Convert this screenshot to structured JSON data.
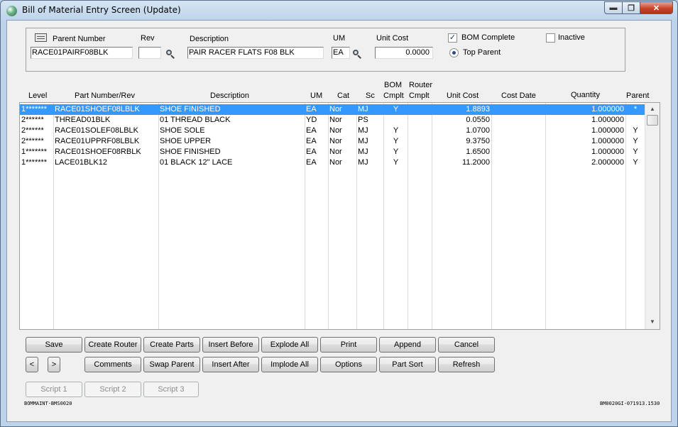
{
  "window": {
    "title": "Bill of Material Entry Screen (Update)",
    "min_glyph": "▬",
    "max_glyph": "❐",
    "close_glyph": "✕"
  },
  "header": {
    "parent_number_label": "Parent Number",
    "parent_number_value": "RACE01PAIRF08BLK",
    "rev_label": "Rev",
    "rev_value": "",
    "description_label": "Description",
    "description_value": "PAIR RACER FLATS F08 BLK",
    "um_label": "UM",
    "um_value": "EA",
    "unit_cost_label": "Unit Cost",
    "unit_cost_value": "0.0000",
    "bom_complete_label": "BOM Complete",
    "bom_complete_checked": true,
    "inactive_label": "Inactive",
    "inactive_checked": false,
    "top_parent_label": "Top Parent",
    "top_parent_selected": true
  },
  "grid": {
    "columns": {
      "level": "Level",
      "part": "Part Number/Rev",
      "description": "Description",
      "um": "UM",
      "cat": "Cat",
      "sc": "Sc",
      "bom_cmplt_1": "BOM",
      "bom_cmplt_2": "Cmplt",
      "router_cmplt_1": "Router",
      "router_cmplt_2": "Cmplt",
      "unit_cost": "Unit Cost",
      "cost_date": "Cost Date",
      "quantity": "Quantity",
      "parent": "Parent"
    },
    "rows": [
      {
        "level": "1*******",
        "part": "RACE01SHOEF08LBLK",
        "description": "SHOE FINISHED",
        "um": "EA",
        "cat": "Nor",
        "sc": "MJ",
        "bom": "Y",
        "router": "",
        "unit_cost": "1.8893",
        "cost_date": "",
        "quantity": "1.000000",
        "parent": "*"
      },
      {
        "level": "2******",
        "part": "THREAD01BLK",
        "description": "01 THREAD BLACK",
        "um": "YD",
        "cat": "Nor",
        "sc": "PS",
        "bom": "",
        "router": "",
        "unit_cost": "0.0550",
        "cost_date": "",
        "quantity": "1.000000",
        "parent": ""
      },
      {
        "level": "2******",
        "part": "RACE01SOLEF08LBLK",
        "description": "SHOE SOLE",
        "um": "EA",
        "cat": "Nor",
        "sc": "MJ",
        "bom": "Y",
        "router": "",
        "unit_cost": "1.0700",
        "cost_date": "",
        "quantity": "1.000000",
        "parent": "Y"
      },
      {
        "level": "2******",
        "part": "RACE01UPPRF08LBLK",
        "description": "SHOE UPPER",
        "um": "EA",
        "cat": "Nor",
        "sc": "MJ",
        "bom": "Y",
        "router": "",
        "unit_cost": "9.3750",
        "cost_date": "",
        "quantity": "1.000000",
        "parent": "Y"
      },
      {
        "level": "1*******",
        "part": "RACE01SHOEF08RBLK",
        "description": "SHOE FINISHED",
        "um": "EA",
        "cat": "Nor",
        "sc": "MJ",
        "bom": "Y",
        "router": "",
        "unit_cost": "1.6500",
        "cost_date": "",
        "quantity": "1.000000",
        "parent": "Y"
      },
      {
        "level": "1*******",
        "part": "LACE01BLK12",
        "description": "01 BLACK 12\" LACE",
        "um": "EA",
        "cat": "Nor",
        "sc": "MJ",
        "bom": "Y",
        "router": "",
        "unit_cost": "11.2000",
        "cost_date": "",
        "quantity": "2.000000",
        "parent": "Y"
      }
    ],
    "selected_row": 0,
    "scroll_up": "▲",
    "scroll_down": "▼"
  },
  "buttons": {
    "save": "Save",
    "create_router": "Create Router",
    "create_parts": "Create Parts",
    "insert_before": "Insert Before",
    "explode_all": "Explode All",
    "print": "Print",
    "append": "Append",
    "cancel": "Cancel",
    "prev": "<",
    "next": ">",
    "comments": "Comments",
    "swap_parent": "Swap Parent",
    "insert_after": "Insert After",
    "implode_all": "Implode All",
    "options": "Options",
    "part_sort": "Part Sort",
    "refresh": "Refresh",
    "script1": "Script 1",
    "script2": "Script 2",
    "script3": "Script 3"
  },
  "footer": {
    "left": "BOMMAINT-BMS0020",
    "right": "BM0020GI-071913.1530"
  },
  "colors": {
    "selection": "#3399ff",
    "close_button": "#c8442b"
  }
}
